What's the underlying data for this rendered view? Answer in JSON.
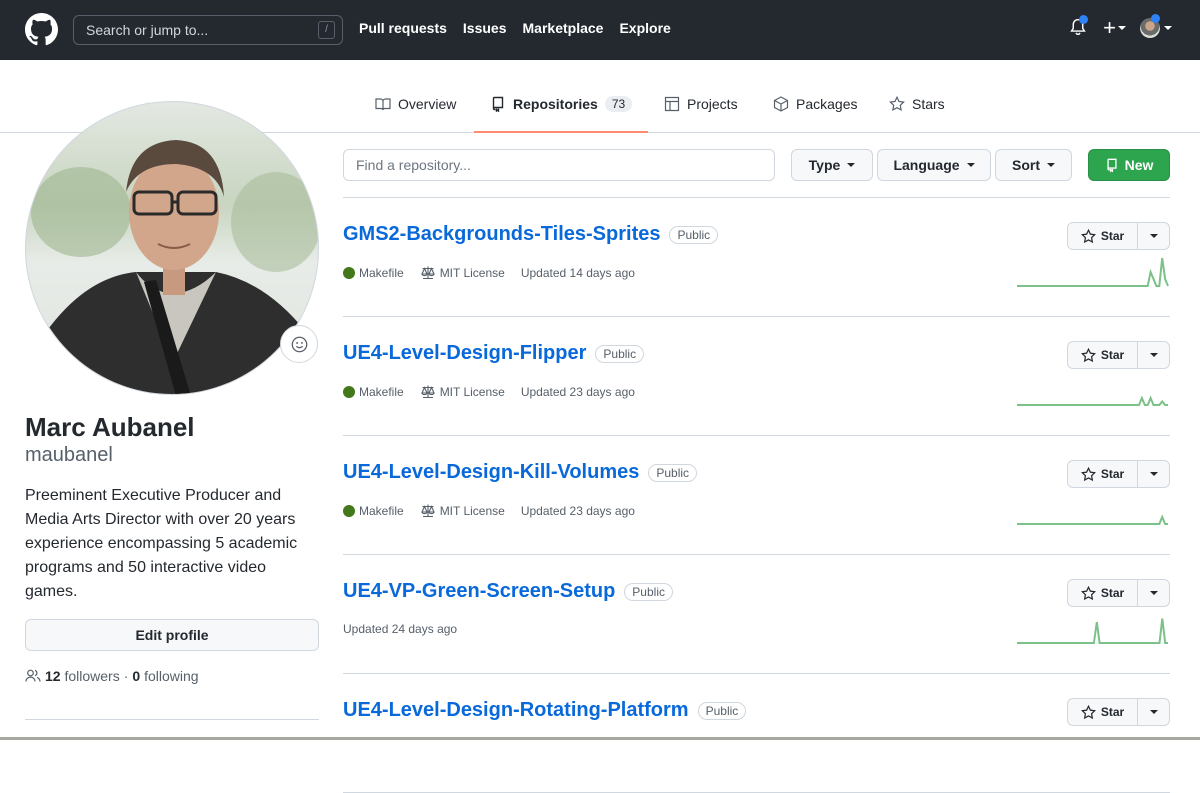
{
  "header": {
    "search_placeholder": "Search or jump to...",
    "search_shortcut": "/",
    "nav": [
      "Pull requests",
      "Issues",
      "Marketplace",
      "Explore"
    ],
    "accent": "#2f81f7"
  },
  "tabs": [
    {
      "label": "Overview",
      "icon": "book-icon"
    },
    {
      "label": "Repositories",
      "icon": "repo-icon",
      "count": "73",
      "active": true
    },
    {
      "label": "Projects",
      "icon": "table-icon"
    },
    {
      "label": "Packages",
      "icon": "package-icon"
    },
    {
      "label": "Stars",
      "icon": "star-icon"
    }
  ],
  "profile": {
    "name": "Marc Aubanel",
    "login": "maubanel",
    "bio": "Preeminent Executive Producer and Media Arts Director with over 20 years experience encompassing 5 academic programs and 50 interactive video games.",
    "edit_label": "Edit profile",
    "followers_count": "12",
    "followers_label": "followers",
    "separator": "·",
    "following_count": "0",
    "following_label": "following"
  },
  "filters": {
    "find_placeholder": "Find a repository...",
    "type_label": "Type",
    "language_label": "Language",
    "sort_label": "Sort",
    "new_label": "New",
    "new_color": "#2da44e"
  },
  "repos": [
    {
      "name": "GMS2-Backgrounds-Tiles-Sprites",
      "visibility": "Public",
      "language": "Makefile",
      "language_color": "#427819",
      "license": "MIT License",
      "updated": "Updated 14 days ago",
      "star_label": "Star",
      "activity": [
        0,
        0,
        0,
        0,
        0,
        0,
        0,
        0,
        0,
        0,
        0,
        0,
        0,
        0,
        0,
        0,
        0,
        0,
        0,
        0,
        0,
        0,
        0,
        0,
        0,
        0,
        0,
        0,
        0,
        0,
        0,
        0,
        0,
        0,
        0,
        0,
        0,
        0,
        0,
        0,
        0,
        0,
        0,
        0,
        0,
        0,
        2,
        1,
        0,
        0,
        4,
        1,
        0
      ]
    },
    {
      "name": "UE4-Level-Design-Flipper",
      "visibility": "Public",
      "language": "Makefile",
      "language_color": "#427819",
      "license": "MIT License",
      "updated": "Updated 23 days ago",
      "star_label": "Star",
      "activity": [
        0,
        0,
        0,
        0,
        0,
        0,
        0,
        0,
        0,
        0,
        0,
        0,
        0,
        0,
        0,
        0,
        0,
        0,
        0,
        0,
        0,
        0,
        0,
        0,
        0,
        0,
        0,
        0,
        0,
        0,
        0,
        0,
        0,
        0,
        0,
        0,
        0,
        0,
        0,
        0,
        0,
        0,
        0,
        1,
        0,
        0,
        1,
        0,
        0,
        0,
        0.5,
        0,
        0
      ]
    },
    {
      "name": "UE4-Level-Design-Kill-Volumes",
      "visibility": "Public",
      "language": "Makefile",
      "language_color": "#427819",
      "license": "MIT License",
      "updated": "Updated 23 days ago",
      "star_label": "Star",
      "activity": [
        0,
        0,
        0,
        0,
        0,
        0,
        0,
        0,
        0,
        0,
        0,
        0,
        0,
        0,
        0,
        0,
        0,
        0,
        0,
        0,
        0,
        0,
        0,
        0,
        0,
        0,
        0,
        0,
        0,
        0,
        0,
        0,
        0,
        0,
        0,
        0,
        0,
        0,
        0,
        0,
        0,
        0,
        0,
        0,
        0,
        0,
        0,
        0,
        0,
        0,
        1,
        0,
        0
      ]
    },
    {
      "name": "UE4-VP-Green-Screen-Setup",
      "visibility": "Public",
      "updated": "Updated 24 days ago",
      "star_label": "Star",
      "activity": [
        0,
        0,
        0,
        0,
        0,
        0,
        0,
        0,
        0,
        0,
        0,
        0,
        0,
        0,
        0,
        0,
        0,
        0,
        0,
        0,
        0,
        0,
        0,
        0,
        0,
        0,
        0,
        0,
        3,
        0,
        0,
        0,
        0,
        0,
        0,
        0,
        0,
        0,
        0,
        0,
        0,
        0,
        0,
        0,
        0,
        0,
        0,
        0,
        0,
        0,
        0,
        3.5,
        0,
        0
      ]
    },
    {
      "name": "UE4-Level-Design-Rotating-Platform",
      "visibility": "Public",
      "star_label": "Star"
    }
  ]
}
